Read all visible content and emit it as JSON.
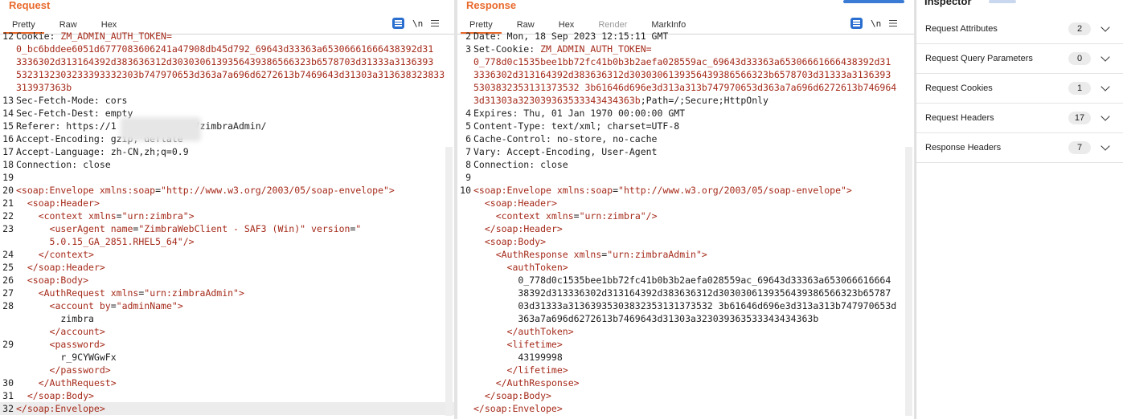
{
  "request": {
    "title": "Request",
    "tabs": [
      "Pretty",
      "Raw",
      "Hex"
    ],
    "lines": [
      {
        "n": "12",
        "segs": [
          [
            "k",
            "Cookie: "
          ],
          [
            "v",
            "ZM_ADMIN_AUTH_TOKEN="
          ]
        ]
      },
      {
        "n": "",
        "segs": [
          [
            "v",
            "0_bc6bddee6051d6777083606241a47908db45d792_69643d33363a65306661666438392d31"
          ]
        ]
      },
      {
        "n": "",
        "segs": [
          [
            "v",
            "3336302d313164392d383636312d3030306139356439386566323b6578703d31333a3136393"
          ]
        ]
      },
      {
        "n": "",
        "segs": [
          [
            "v",
            "5323132303233393332303b747970653d363a7a696d6272613b7469643d31303a313638323833"
          ]
        ]
      },
      {
        "n": "",
        "segs": [
          [
            "v",
            "313937363b"
          ]
        ]
      },
      {
        "n": "13",
        "segs": [
          [
            "k",
            "Sec-Fetch-Mode: cors"
          ]
        ]
      },
      {
        "n": "14",
        "segs": [
          [
            "k",
            "Sec-Fetch-Dest: empty"
          ]
        ]
      },
      {
        "n": "15",
        "segs": [
          [
            "k",
            "Referer: https://1          7071/zimbraAdmin/"
          ]
        ]
      },
      {
        "n": "16",
        "segs": [
          [
            "k",
            "Accept-Encoding: gzip, deflate"
          ]
        ]
      },
      {
        "n": "17",
        "segs": [
          [
            "k",
            "Accept-Language: zh-CN,zh;q=0.9"
          ]
        ]
      },
      {
        "n": "18",
        "segs": [
          [
            "k",
            "Connection: close"
          ]
        ]
      },
      {
        "n": "19",
        "segs": []
      },
      {
        "n": "20",
        "segs": [
          [
            "tg",
            "<soap:Envelope "
          ],
          [
            "at",
            "xmlns:soap"
          ],
          [
            "k",
            "="
          ],
          [
            "v",
            "\"http://www.w3.org/2003/05/soap-envelope\""
          ],
          [
            "tg",
            ">"
          ]
        ]
      },
      {
        "n": "21",
        "segs": [
          [
            "k",
            "  "
          ],
          [
            "tg",
            "<soap:Header>"
          ]
        ]
      },
      {
        "n": "22",
        "segs": [
          [
            "k",
            "    "
          ],
          [
            "tg",
            "<context "
          ],
          [
            "at",
            "xmlns"
          ],
          [
            "k",
            "="
          ],
          [
            "v",
            "\"urn:zimbra\""
          ],
          [
            "tg",
            ">"
          ]
        ]
      },
      {
        "n": "23",
        "segs": [
          [
            "k",
            "      "
          ],
          [
            "tg",
            "<userAgent "
          ],
          [
            "at",
            "name"
          ],
          [
            "k",
            "="
          ],
          [
            "v",
            "\"ZimbraWebClient - SAF3 (Win)\""
          ],
          [
            "k",
            " "
          ],
          [
            "at",
            "version"
          ],
          [
            "k",
            "="
          ],
          [
            "v",
            "\""
          ]
        ]
      },
      {
        "n": "",
        "segs": [
          [
            "v",
            "      5.0.15_GA_2851.RHEL5_64\""
          ],
          [
            "tg",
            "/>"
          ]
        ]
      },
      {
        "n": "24",
        "segs": [
          [
            "k",
            "    "
          ],
          [
            "tg",
            "</context>"
          ]
        ]
      },
      {
        "n": "25",
        "segs": [
          [
            "k",
            "  "
          ],
          [
            "tg",
            "</soap:Header>"
          ]
        ]
      },
      {
        "n": "26",
        "segs": [
          [
            "k",
            "  "
          ],
          [
            "tg",
            "<soap:Body>"
          ]
        ]
      },
      {
        "n": "27",
        "segs": [
          [
            "k",
            "    "
          ],
          [
            "tg",
            "<AuthRequest "
          ],
          [
            "at",
            "xmlns"
          ],
          [
            "k",
            "="
          ],
          [
            "v",
            "\"urn:zimbraAdmin\""
          ],
          [
            "tg",
            ">"
          ]
        ]
      },
      {
        "n": "28",
        "segs": [
          [
            "k",
            "      "
          ],
          [
            "tg",
            "<account "
          ],
          [
            "at",
            "by"
          ],
          [
            "k",
            "="
          ],
          [
            "v",
            "\"adminName\""
          ],
          [
            "tg",
            ">"
          ]
        ]
      },
      {
        "n": "",
        "segs": [
          [
            "k",
            "        zimbra"
          ]
        ]
      },
      {
        "n": "",
        "segs": [
          [
            "k",
            "      "
          ],
          [
            "tg",
            "</account>"
          ]
        ]
      },
      {
        "n": "29",
        "segs": [
          [
            "k",
            "      "
          ],
          [
            "tg",
            "<password>"
          ]
        ]
      },
      {
        "n": "",
        "segs": [
          [
            "k",
            "        r_9CYWGwFx"
          ]
        ]
      },
      {
        "n": "",
        "segs": [
          [
            "k",
            "      "
          ],
          [
            "tg",
            "</password>"
          ]
        ]
      },
      {
        "n": "30",
        "segs": [
          [
            "k",
            "    "
          ],
          [
            "tg",
            "</AuthRequest>"
          ]
        ]
      },
      {
        "n": "31",
        "segs": [
          [
            "k",
            "  "
          ],
          [
            "tg",
            "</soap:Body>"
          ]
        ]
      },
      {
        "n": "32",
        "segs": [
          [
            "tg",
            "</soap:Envelope>"
          ]
        ],
        "hl": true
      }
    ]
  },
  "response": {
    "title": "Response",
    "tabs": [
      "Pretty",
      "Raw",
      "Hex",
      "Render",
      "MarkInfo"
    ],
    "lines": [
      {
        "n": "2",
        "segs": [
          [
            "k",
            "Date: Mon, 18 Sep 2023 12:15:11 GMT"
          ]
        ]
      },
      {
        "n": "3",
        "segs": [
          [
            "k",
            "Set-Cookie: "
          ],
          [
            "v",
            "ZM_ADMIN_AUTH_TOKEN="
          ]
        ]
      },
      {
        "n": "",
        "segs": [
          [
            "v",
            "0_778d0c1535bee1bb72fc41b0b3b2aefa028559ac_69643d33363a65306661666438392d31"
          ]
        ]
      },
      {
        "n": "",
        "segs": [
          [
            "v",
            "3336302d313164392d383636312d3030306139356439386566323b6578703d31333a3136393"
          ]
        ]
      },
      {
        "n": "",
        "segs": [
          [
            "v",
            "5303832353131373532 3b61646d696e3d313a313b747970653d363a7a696d6272613b746964"
          ]
        ]
      },
      {
        "n": "",
        "segs": [
          [
            "v",
            "3d31303a323039363533343434363b"
          ],
          [
            "k",
            ";Path=/;Secure;HttpOnly"
          ]
        ]
      },
      {
        "n": "4",
        "segs": [
          [
            "k",
            "Expires: Thu, 01 Jan 1970 00:00:00 GMT"
          ]
        ]
      },
      {
        "n": "5",
        "segs": [
          [
            "k",
            "Content-Type: text/xml; charset=UTF-8"
          ]
        ]
      },
      {
        "n": "6",
        "segs": [
          [
            "k",
            "Cache-Control: no-store, no-cache"
          ]
        ]
      },
      {
        "n": "7",
        "segs": [
          [
            "k",
            "Vary: Accept-Encoding, User-Agent"
          ]
        ]
      },
      {
        "n": "8",
        "segs": [
          [
            "k",
            "Connection: close"
          ]
        ]
      },
      {
        "n": "9",
        "segs": []
      },
      {
        "n": "10",
        "segs": [
          [
            "tg",
            "<soap:Envelope "
          ],
          [
            "at",
            "xmlns:soap"
          ],
          [
            "k",
            "="
          ],
          [
            "v",
            "\"http://www.w3.org/2003/05/soap-envelope\""
          ],
          [
            "tg",
            ">"
          ]
        ]
      },
      {
        "n": "",
        "segs": [
          [
            "k",
            "  "
          ],
          [
            "tg",
            "<soap:Header>"
          ]
        ]
      },
      {
        "n": "",
        "segs": [
          [
            "k",
            "    "
          ],
          [
            "tg",
            "<context "
          ],
          [
            "at",
            "xmlns"
          ],
          [
            "k",
            "="
          ],
          [
            "v",
            "\"urn:zimbra\""
          ],
          [
            "tg",
            "/>"
          ]
        ]
      },
      {
        "n": "",
        "segs": [
          [
            "k",
            "  "
          ],
          [
            "tg",
            "</soap:Header>"
          ]
        ]
      },
      {
        "n": "",
        "segs": [
          [
            "k",
            "  "
          ],
          [
            "tg",
            "<soap:Body>"
          ]
        ]
      },
      {
        "n": "",
        "segs": [
          [
            "k",
            "    "
          ],
          [
            "tg",
            "<AuthResponse "
          ],
          [
            "at",
            "xmlns"
          ],
          [
            "k",
            "="
          ],
          [
            "v",
            "\"urn:zimbraAdmin\""
          ],
          [
            "tg",
            ">"
          ]
        ]
      },
      {
        "n": "",
        "segs": [
          [
            "k",
            "      "
          ],
          [
            "tg",
            "<authToken>"
          ]
        ]
      },
      {
        "n": "",
        "segs": [
          [
            "k",
            "        0_778d0c1535bee1bb72fc41b0b3b2aefa028559ac_69643d33363a653066616664"
          ]
        ]
      },
      {
        "n": "",
        "segs": [
          [
            "k",
            "        38392d313336302d313164392d383636312d3030306139356439386566323b65787"
          ]
        ]
      },
      {
        "n": "",
        "segs": [
          [
            "k",
            "        03d31333a31363935303832353131373532 3b61646d696e3d313a313b747970653d"
          ]
        ]
      },
      {
        "n": "",
        "segs": [
          [
            "k",
            "        363a7a696d6272613b7469643d31303a323039363533343434363b"
          ]
        ]
      },
      {
        "n": "",
        "segs": [
          [
            "k",
            "      "
          ],
          [
            "tg",
            "</authToken>"
          ]
        ]
      },
      {
        "n": "",
        "segs": [
          [
            "k",
            "      "
          ],
          [
            "tg",
            "<lifetime>"
          ]
        ]
      },
      {
        "n": "",
        "segs": [
          [
            "k",
            "        43199998"
          ]
        ]
      },
      {
        "n": "",
        "segs": [
          [
            "k",
            "      "
          ],
          [
            "tg",
            "</lifetime>"
          ]
        ]
      },
      {
        "n": "",
        "segs": [
          [
            "k",
            "    "
          ],
          [
            "tg",
            "</AuthResponse>"
          ]
        ]
      },
      {
        "n": "",
        "segs": [
          [
            "k",
            "  "
          ],
          [
            "tg",
            "</soap:Body>"
          ]
        ]
      },
      {
        "n": "",
        "segs": [
          [
            "tg",
            "</soap:Envelope>"
          ]
        ]
      }
    ]
  },
  "inspector": {
    "title": "Inspector",
    "sections": [
      {
        "label": "Request Attributes",
        "count": "2"
      },
      {
        "label": "Request Query Parameters",
        "count": "0"
      },
      {
        "label": "Request Cookies",
        "count": "1"
      },
      {
        "label": "Request Headers",
        "count": "17"
      },
      {
        "label": "Response Headers",
        "count": "7"
      }
    ]
  },
  "toolbar": {
    "newline_label": "\\n"
  },
  "colors": {
    "accent": "#e8692b",
    "value": "#a52a1a",
    "button": "#2a6fd0"
  }
}
